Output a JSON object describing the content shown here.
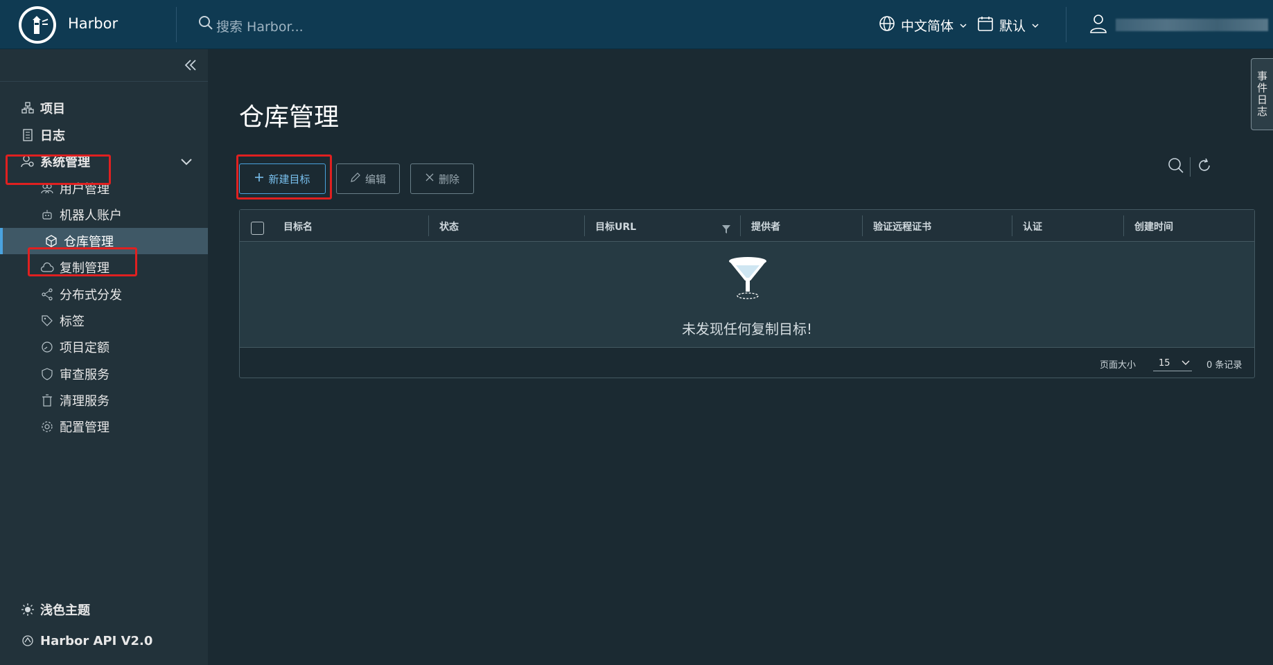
{
  "header": {
    "app_title": "Harbor",
    "search_placeholder": "搜索 Harbor...",
    "language": "中文简体",
    "theme": "默认"
  },
  "sidebar": {
    "items": [
      {
        "label": "项目",
        "icon": "projects-icon"
      },
      {
        "label": "日志",
        "icon": "logs-icon"
      },
      {
        "label": "系统管理",
        "icon": "admin-icon"
      },
      {
        "label": "用户管理",
        "icon": "users-icon"
      },
      {
        "label": "机器人账户",
        "icon": "robot-icon"
      },
      {
        "label": "仓库管理",
        "icon": "cube-icon"
      },
      {
        "label": "复制管理",
        "icon": "cloud-icon"
      },
      {
        "label": "分布式分发",
        "icon": "share-icon"
      },
      {
        "label": "标签",
        "icon": "tag-icon"
      },
      {
        "label": "项目定额",
        "icon": "gauge-icon"
      },
      {
        "label": "审查服务",
        "icon": "shield-icon"
      },
      {
        "label": "清理服务",
        "icon": "trash-icon"
      },
      {
        "label": "配置管理",
        "icon": "gear-icon"
      }
    ],
    "light_theme": "浅色主题",
    "api": "Harbor API V2.0"
  },
  "main": {
    "title": "仓库管理",
    "buttons": {
      "new_target": "新建目标",
      "edit": "编辑",
      "delete": "删除"
    },
    "columns": [
      "目标名",
      "状态",
      "目标URL",
      "提供者",
      "验证远程证书",
      "认证",
      "创建时间"
    ],
    "empty_message": "未发现任何复制目标!",
    "footer": {
      "page_size_label": "页面大小",
      "page_size": "15",
      "record_count": "0 条记录"
    }
  },
  "side_tab": "事件日志"
}
